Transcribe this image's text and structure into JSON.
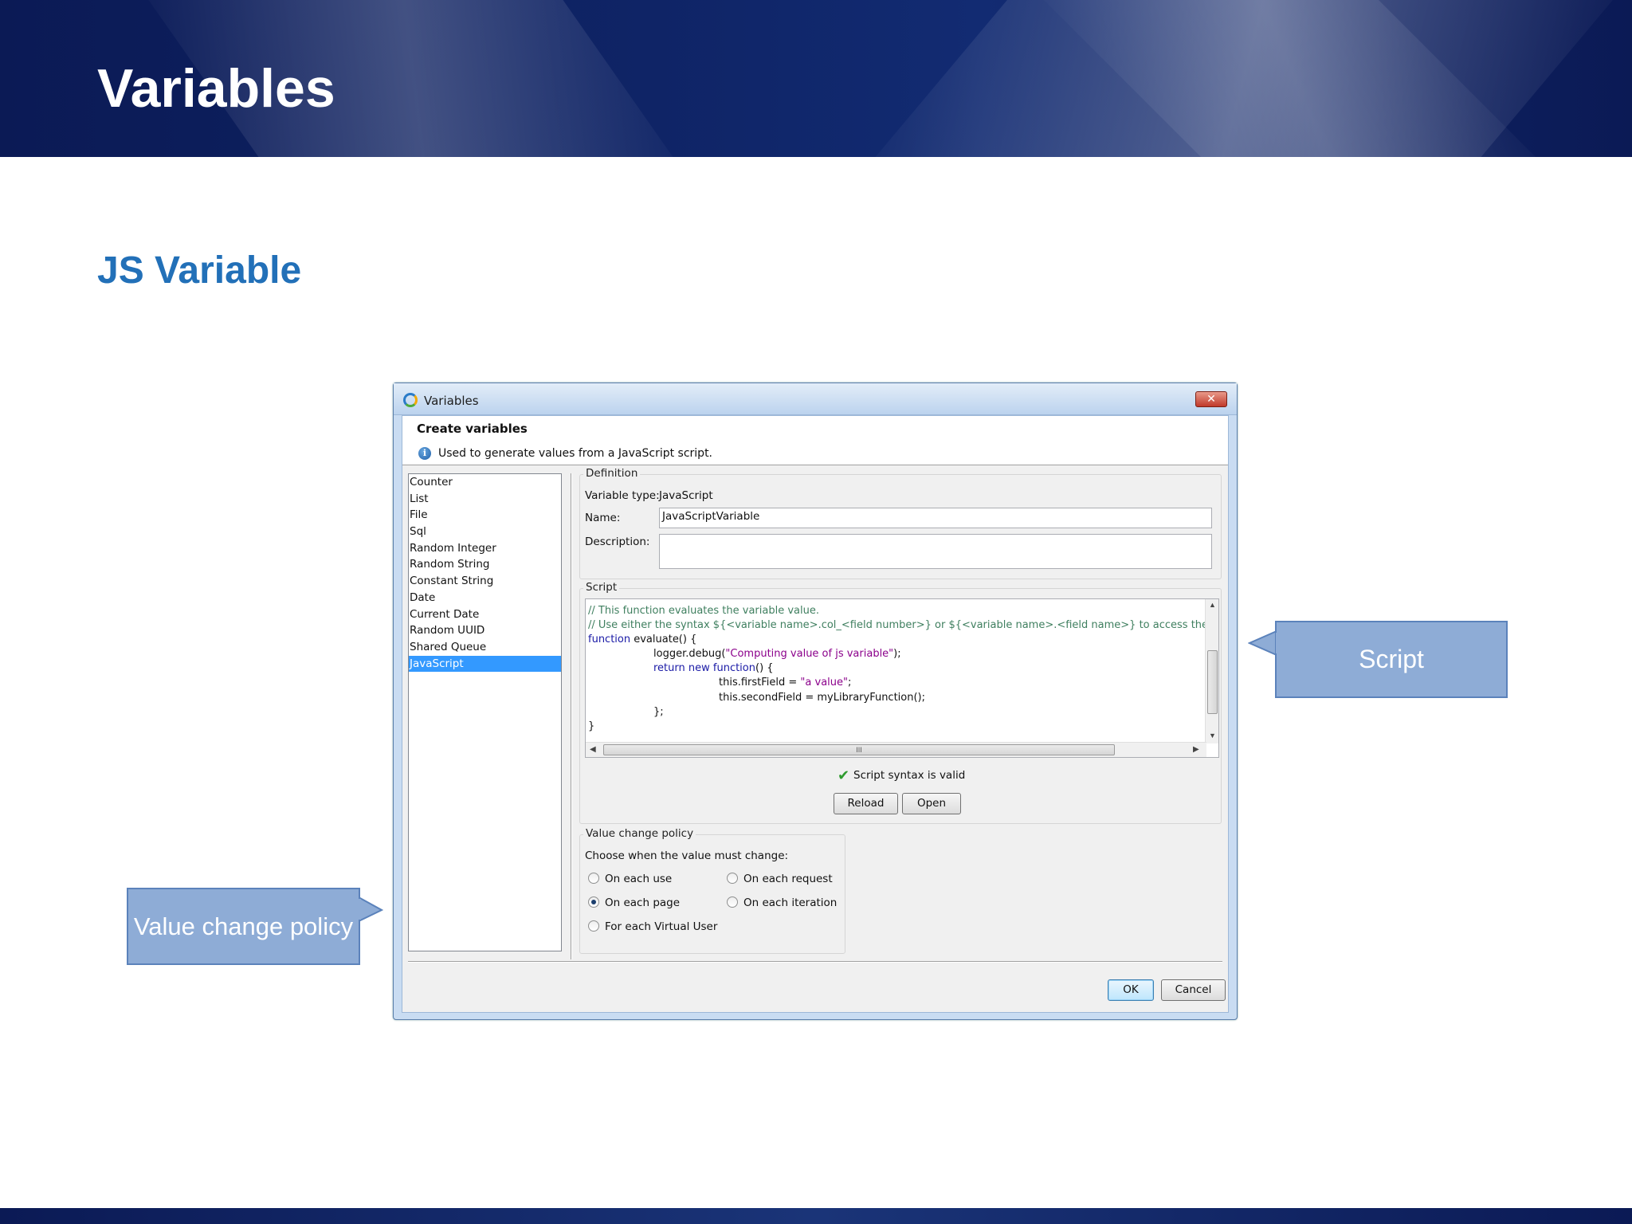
{
  "slide": {
    "title": "Variables",
    "subtitle": "JS Variable"
  },
  "dialog": {
    "window_title": "Variables",
    "close_glyph": "✕",
    "header_title": "Create variables",
    "header_description": "Used to generate values from a JavaScript script.",
    "variable_types": [
      {
        "label": "Counter",
        "selected": false
      },
      {
        "label": "List",
        "selected": false
      },
      {
        "label": "File",
        "selected": false
      },
      {
        "label": "Sql",
        "selected": false
      },
      {
        "label": "Random Integer",
        "selected": false
      },
      {
        "label": "Random String",
        "selected": false
      },
      {
        "label": "Constant String",
        "selected": false
      },
      {
        "label": "Date",
        "selected": false
      },
      {
        "label": "Current Date",
        "selected": false
      },
      {
        "label": "Random UUID",
        "selected": false
      },
      {
        "label": "Shared Queue",
        "selected": false
      },
      {
        "label": "JavaScript",
        "selected": true
      }
    ],
    "definition": {
      "group_label": "Definition",
      "type_label": "Variable type:",
      "type_value": "JavaScript",
      "name_label": "Name:",
      "name_value": "JavaScriptVariable",
      "description_label": "Description:",
      "description_value": ""
    },
    "script": {
      "group_label": "Script",
      "lines": [
        "// This function evaluates the variable value.",
        "// Use either the syntax ${<variable name>.col_<field number>} or ${<variable name>.<field name>} to access the value",
        "function evaluate() {",
        "\t\tlogger.debug(\"Computing value of js variable\");",
        "\t\treturn new function() {",
        "\t\t\t\tthis.firstField = \"a value\";",
        "\t\t\t\tthis.secondField = myLibraryFunction();",
        "\t\t};",
        "}"
      ],
      "scroll_grip": "III",
      "validity_text": "Script syntax is valid",
      "reload_label": "Reload",
      "open_label": "Open"
    },
    "policy": {
      "group_label": "Value change policy",
      "prompt": "Choose when the value must change:",
      "options": [
        {
          "label": "On each use",
          "selected": false
        },
        {
          "label": "On each request",
          "selected": false
        },
        {
          "label": "On each page",
          "selected": true
        },
        {
          "label": "On each iteration",
          "selected": false
        },
        {
          "label": "For each Virtual User",
          "selected": false
        }
      ]
    },
    "ok_label": "OK",
    "cancel_label": "Cancel"
  },
  "callouts": {
    "script": "Script",
    "policy": "Value change policy"
  },
  "colors": {
    "banner": "#0f2466",
    "subtitle": "#2270b8",
    "callout_fill": "#8eacd6",
    "callout_border": "#5b82bb",
    "selection": "#3399ff"
  }
}
